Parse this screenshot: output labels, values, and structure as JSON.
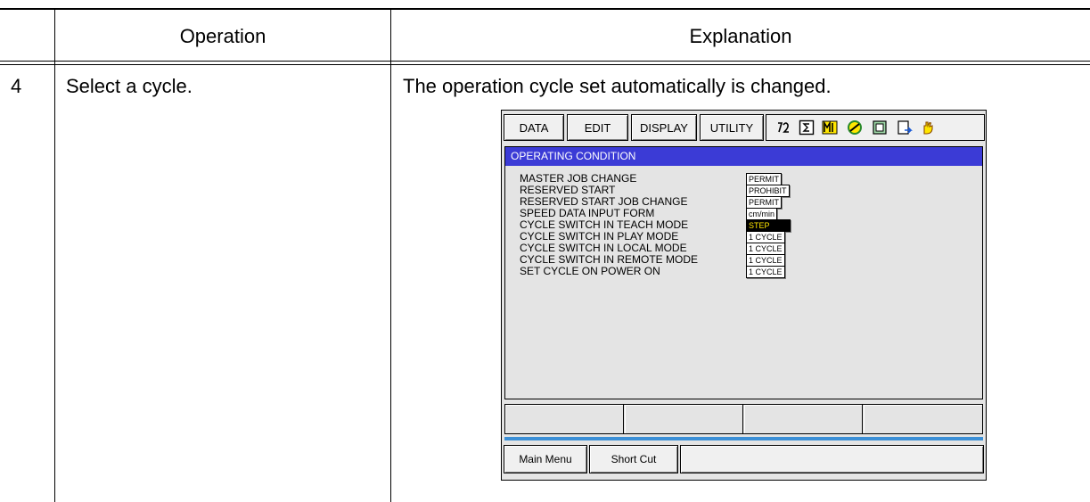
{
  "table": {
    "header_operation": "Operation",
    "header_explanation": "Explanation",
    "step_number": "4",
    "step_operation": "Select a cycle.",
    "step_explanation": "The operation cycle set automatically is changed."
  },
  "pendant": {
    "menu": [
      "DATA",
      "EDIT",
      "DISPLAY",
      "UTILITY"
    ],
    "status_icons": [
      "cycle-icon",
      "sigma-icon",
      "mode-icon",
      "tool-icon",
      "screen-icon",
      "edit-lock-icon",
      "hand-icon"
    ],
    "panel_title": "OPERATING CONDITION",
    "conditions": [
      {
        "label": "MASTER JOB CHANGE",
        "value": "PERMIT",
        "selected": false
      },
      {
        "label": "RESERVED START",
        "value": "PROHIBIT",
        "selected": false
      },
      {
        "label": "RESERVED START JOB CHANGE",
        "value": "PERMIT",
        "selected": false
      },
      {
        "label": "SPEED DATA INPUT FORM",
        "value": "cm/min",
        "selected": false
      },
      {
        "label": "CYCLE SWITCH IN TEACH MODE",
        "value": "STEP",
        "selected": true
      },
      {
        "label": "CYCLE SWITCH IN PLAY MODE",
        "value": "1 CYCLE",
        "selected": false
      },
      {
        "label": "CYCLE SWITCH IN LOCAL MODE",
        "value": "1 CYCLE",
        "selected": false
      },
      {
        "label": "CYCLE SWITCH IN REMOTE MODE",
        "value": "1 CYCLE",
        "selected": false
      },
      {
        "label": "SET CYCLE ON POWER ON",
        "value": "1 CYCLE",
        "selected": false
      }
    ],
    "bottom_buttons": [
      "Main Menu",
      "Short Cut"
    ],
    "colors": {
      "title_bar": "#3b3bd6",
      "selected_text": "#ffe600",
      "separator": "#3b8fd6"
    }
  }
}
